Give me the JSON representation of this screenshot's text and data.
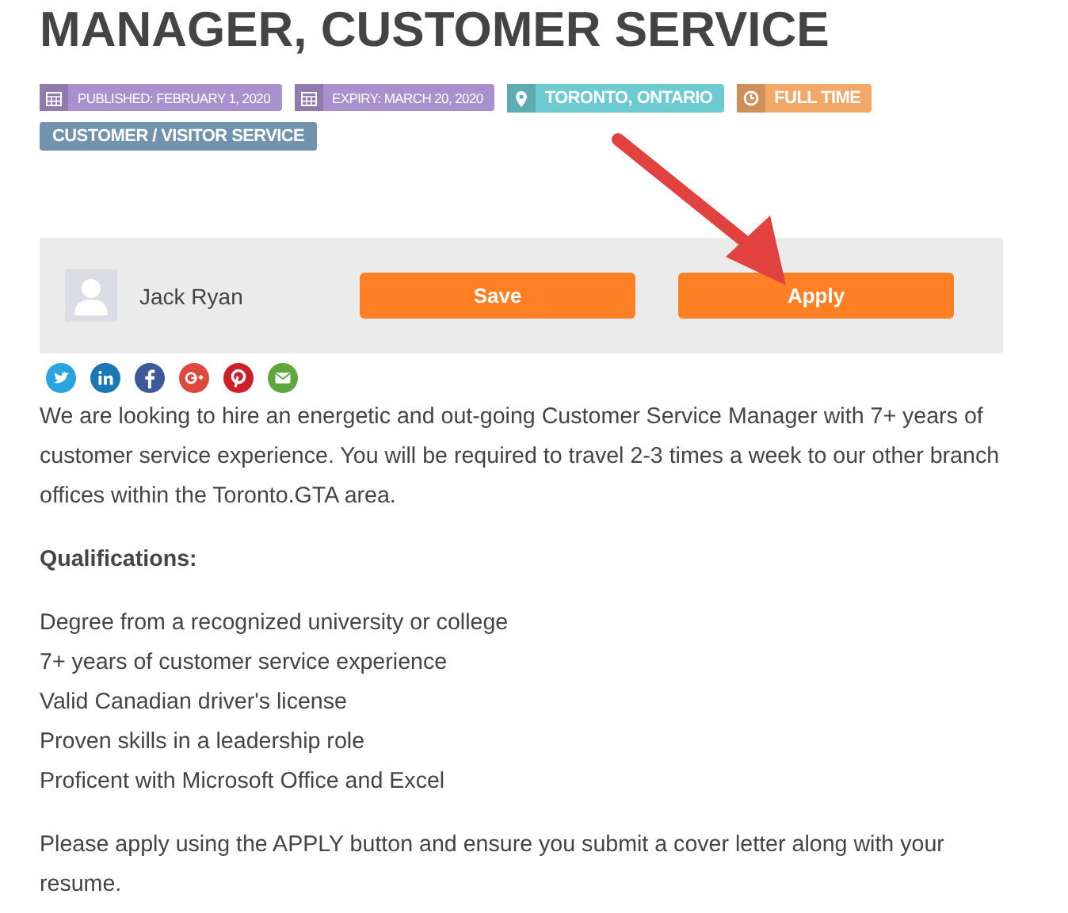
{
  "title": "MANAGER, CUSTOMER SERVICE",
  "tags": [
    {
      "kind": "date",
      "label": "PUBLISHED: FEBRUARY 1, 2020",
      "color": "#a891cc"
    },
    {
      "kind": "date",
      "label": "EXPIRY: MARCH 20, 2020",
      "color": "#a891cc"
    },
    {
      "kind": "location",
      "label": "TORONTO, ONTARIO",
      "color": "#6ccad1"
    },
    {
      "kind": "time",
      "label": "FULL TIME",
      "color": "#f2a867"
    },
    {
      "kind": "category",
      "label": "CUSTOMER / VISITOR SERVICE",
      "color": "#7193ad"
    }
  ],
  "user": {
    "name": "Jack Ryan"
  },
  "buttons": [
    "Save",
    "Apply"
  ],
  "intro": "We are looking to hire an energetic and out-going Customer Service Manager with 7+ years of customer service experience. You will be required to travel 2-3 times a week to our other branch offices within the Toronto.GTA area.",
  "qualifications_heading": "Qualifications:",
  "qualifications": [
    "Degree from a recognized university or college",
    "7+ years of customer service experience",
    "Valid Canadian driver's license",
    "Proven skills in a leadership role",
    "Proficent with Microsoft Office and Excel"
  ],
  "closing": "Please apply using the APPLY button and ensure you submit a cover letter along with your resume."
}
